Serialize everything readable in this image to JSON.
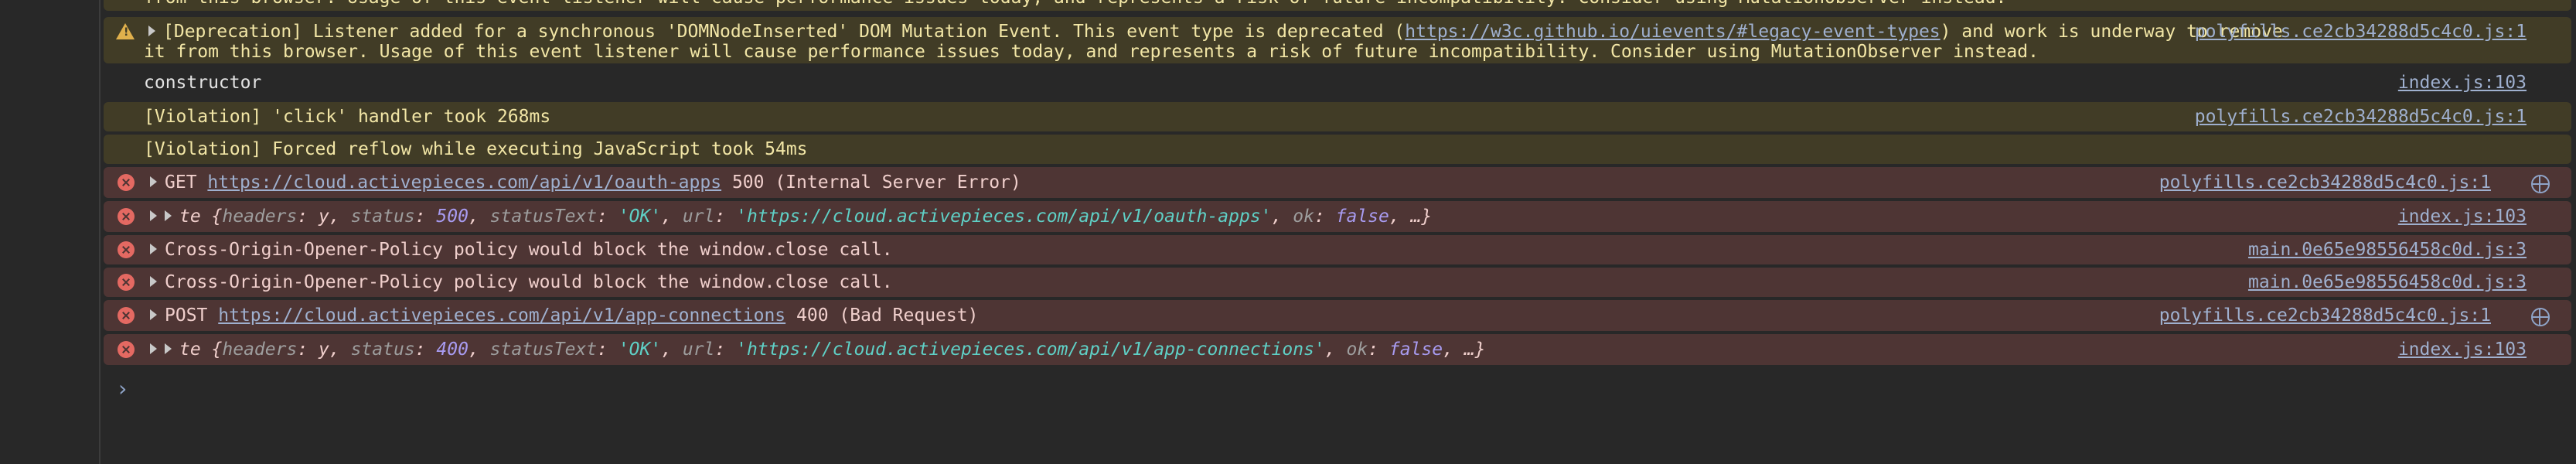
{
  "rows": {
    "top_cut": "from this browser. Usage of this event listener will cause performance issues today, and represents a risk of future incompatibility. Consider using MutationObserver instead.",
    "deprecation": {
      "text_a": "[Deprecation] Listener added for a synchronous 'DOMNodeInserted' DOM Mutation Event. This event type is deprecated (",
      "link": "https://w3c.github.io/uievents/#legacy-event-types",
      "text_b": ") and work is underway to remove",
      "line2": "it from this browser. Usage of this event listener will cause performance issues today, and represents a risk of future incompatibility. Consider using MutationObserver instead.",
      "source": "polyfills.ce2cb34288d5c4c0.js:1"
    },
    "constructor": {
      "text": "constructor",
      "source": "index.js:103"
    },
    "violation_click": {
      "text": "[Violation] 'click' handler took 268ms",
      "source": "polyfills.ce2cb34288d5c4c0.js:1"
    },
    "violation_reflow": {
      "text": "[Violation] Forced reflow while executing JavaScript took 54ms"
    },
    "get_error": {
      "method": "GET",
      "url": "https://cloud.activepieces.com/api/v1/oauth-apps",
      "status": "500 (Internal Server Error)",
      "source": "polyfills.ce2cb34288d5c4c0.js:1"
    },
    "obj_error_1": {
      "prefix": "te {",
      "k1": "headers",
      "v1": "y",
      "k2": "status",
      "v2": "500",
      "k3": "statusText",
      "v3": "'OK'",
      "k4": "url",
      "v4": "'https://cloud.activepieces.com/api/v1/oauth-apps'",
      "k5": "ok",
      "v5": "false",
      "suffix": ", …}",
      "source": "index.js:103"
    },
    "coop_1": {
      "text": "Cross-Origin-Opener-Policy policy would block the window.close call.",
      "source": "main.0e65e98556458c0d.js:3"
    },
    "coop_2": {
      "text": "Cross-Origin-Opener-Policy policy would block the window.close call.",
      "source": "main.0e65e98556458c0d.js:3"
    },
    "post_error": {
      "method": "POST",
      "url": "https://cloud.activepieces.com/api/v1/app-connections",
      "status": "400 (Bad Request)",
      "source": "polyfills.ce2cb34288d5c4c0.js:1"
    },
    "obj_error_2": {
      "prefix": "te {",
      "k1": "headers",
      "v1": "y",
      "k2": "status",
      "v2": "400",
      "k3": "statusText",
      "v3": "'OK'",
      "k4": "url",
      "v4": "'https://cloud.activepieces.com/api/v1/app-connections'",
      "k5": "ok",
      "v5": "false",
      "suffix": ", …}",
      "source": "index.js:103"
    }
  },
  "icons": {
    "warning": "warning-icon",
    "error": "error-icon",
    "expand": "expand-triangle-icon",
    "network": "globe-icon",
    "prompt": "chevron-right-icon"
  },
  "colors": {
    "warning_bg": "#413c26",
    "error_bg": "#4e3534",
    "link": "#9fb0cf"
  }
}
